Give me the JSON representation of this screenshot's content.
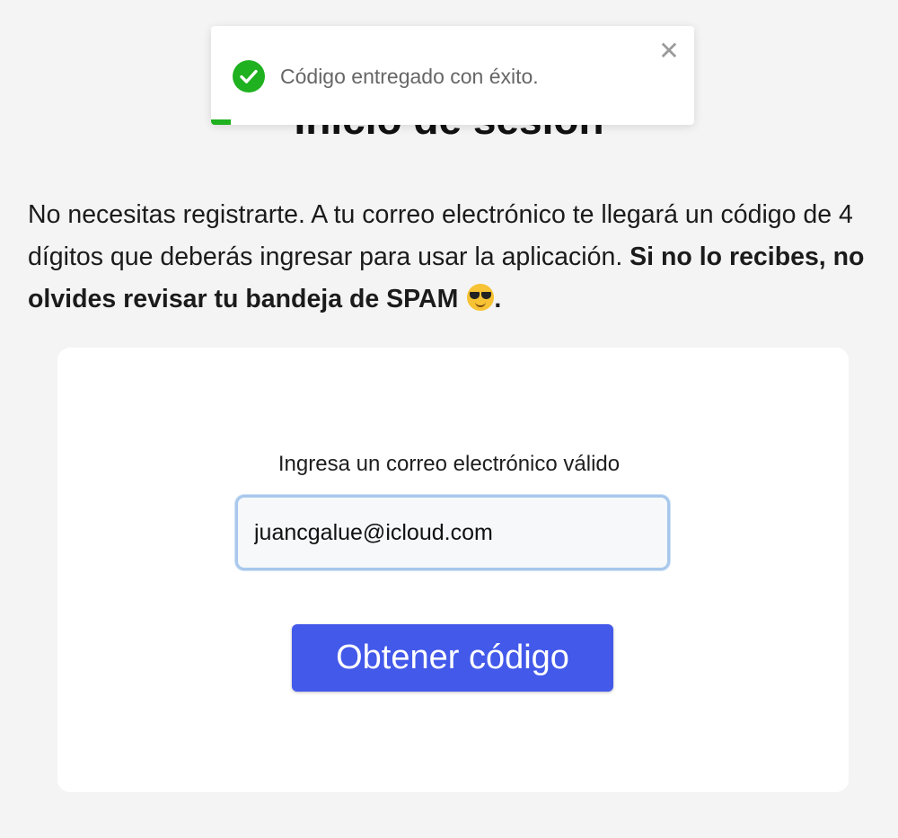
{
  "page": {
    "title": "Inicio de sesión",
    "intro_text": "No necesitas registrarte. A tu correo electrónico te llegará un código de 4 dígitos que deberás ingresar para usar la aplicación. ",
    "intro_bold": "Si no lo recibes, no olvides revisar tu bandeja de SPAM",
    "intro_bold_end": ".",
    "emoji": "smiling-face-with-sunglasses-icon"
  },
  "form": {
    "email_label": "Ingresa un correo electrónico válido",
    "email_value": "juancgalue@icloud.com",
    "submit_label": "Obtener código"
  },
  "toast": {
    "message": "Código entregado con éxito.",
    "close_glyph": "✕",
    "status_icon": "check-circle-icon",
    "progress": 0.04,
    "colors": {
      "success": "#1fb11f"
    }
  },
  "colors": {
    "background": "#f4f4f4",
    "card": "#ffffff",
    "primary_button": "#4359ea",
    "input_focus_border": "#a8c8ec"
  }
}
